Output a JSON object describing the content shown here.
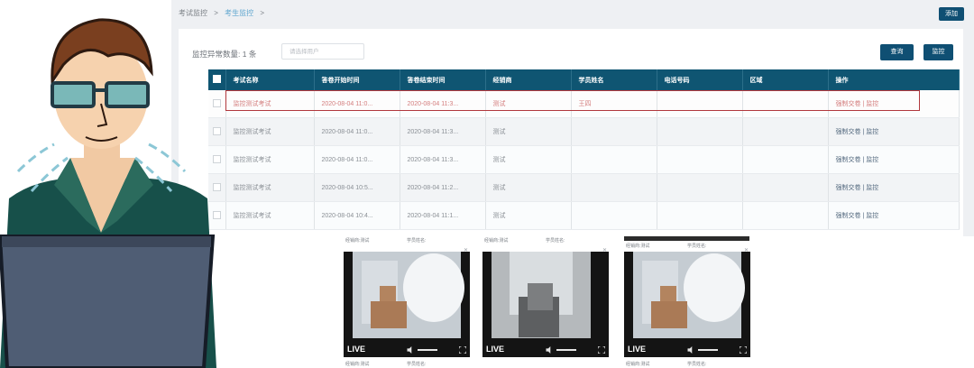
{
  "breadcrumb": {
    "root": "考试监控",
    "current": "考生监控",
    "sep": ">"
  },
  "header": {
    "add_label": "添加"
  },
  "filter": {
    "count_label": "监控异常数量: 1 条",
    "search_placeholder": "请选择用户",
    "query_label": "查询",
    "monitor_label": "监控"
  },
  "table": {
    "columns": [
      "考试名称",
      "答卷开始时间",
      "答卷结束时间",
      "经销商",
      "学员姓名",
      "电话号码",
      "区域",
      "操作"
    ],
    "rows": [
      {
        "name": "监控测试考试",
        "start": "2020-08-04 11:0...",
        "end": "2020-08-04 11:3...",
        "dealer": "测试",
        "student": "王四",
        "phone": "",
        "region": "",
        "ops": "强制交卷 | 监控"
      },
      {
        "name": "监控测试考试",
        "start": "2020-08-04 11:0...",
        "end": "2020-08-04 11:3...",
        "dealer": "测试",
        "student": "",
        "phone": "",
        "region": "",
        "ops": "强制交卷 | 监控"
      },
      {
        "name": "监控测试考试",
        "start": "2020-08-04 11:0...",
        "end": "2020-08-04 11:3...",
        "dealer": "测试",
        "student": "",
        "phone": "",
        "region": "",
        "ops": "强制交卷 | 监控"
      },
      {
        "name": "监控测试考试",
        "start": "2020-08-04 10:5...",
        "end": "2020-08-04 11:2...",
        "dealer": "测试",
        "student": "",
        "phone": "",
        "region": "",
        "ops": "强制交卷 | 监控"
      },
      {
        "name": "监控测试考试",
        "start": "2020-08-04 10:4...",
        "end": "2020-08-04 11:1...",
        "dealer": "测试",
        "student": "",
        "phone": "",
        "region": "",
        "ops": "强制交卷 | 监控"
      }
    ]
  },
  "cams": {
    "live_label": "LIVE",
    "dealer_label": "经销商:测试",
    "student_label": "学员姓名:"
  },
  "colors": {
    "primary": "#0f4f73",
    "header_bg": "#0f5572",
    "highlight": "#b1383d"
  }
}
